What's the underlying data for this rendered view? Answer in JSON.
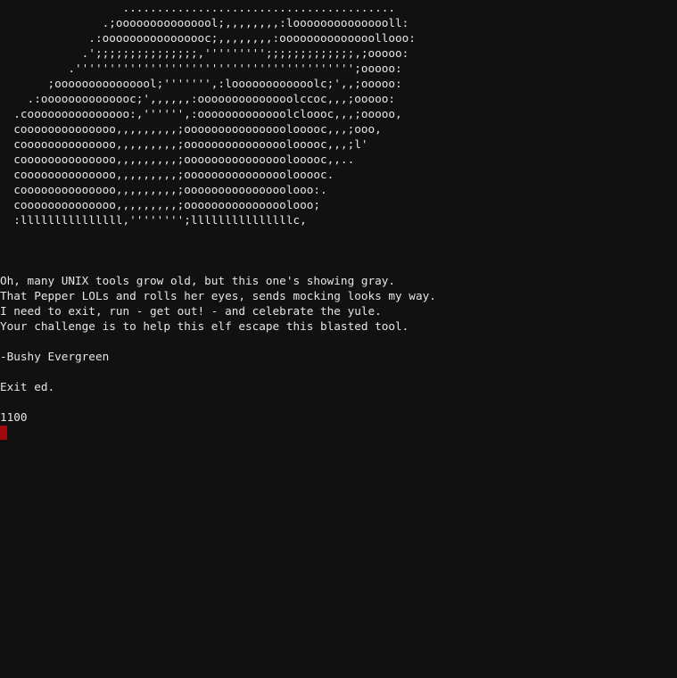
{
  "ascii_art": [
    "                  ........................................",
    "               .;ooooooooooooool;,,,,,,,,:looooooooooooooll:",
    "             .:oooooooooooooooc;,,,,,,,,:oooooooooooooollooo:",
    "            .';;;;;;;;;;;;;;;,''''''''';;;;;;;;;;;;;,;ooooo:",
    "          .''''''''''''''''''''''''''''''''''''''''';ooooo:",
    "       ;ooooooooooooool;''''''',:loooooooooooolc;',,;ooooo:",
    "    .:oooooooooooooc;',,,,,,:oooooooooooooolccoc,,,;ooooo:",
    "  .cooooooooooooooo:,'''''',:ooooooooooooolcloooc,,,;ooooo,",
    "  coooooooooooooo,,,,,,,,,;ooooooooooooooolooooc,,,;ooo,",
    "  coooooooooooooo,,,,,,,,,;ooooooooooooooolooooc,,,;l'",
    "  coooooooooooooo,,,,,,,,,;ooooooooooooooolooooc,,..",
    "  coooooooooooooo,,,,,,,,,;ooooooooooooooolooooc.",
    "  coooooooooooooo,,,,,,,,,;ooooooooooooooolooo:.",
    "  coooooooooooooo,,,,,,,,,;ooooooooooooooolooo;",
    "  :lllllllllllllll,'''''''';lllllllllllllllc,"
  ],
  "poem": {
    "line1": "Oh, many UNIX tools grow old, but this one's showing gray.",
    "line2": "That Pepper LOLs and rolls her eyes, sends mocking looks my way.",
    "line3": "I need to exit, run - get out! - and celebrate the yule.",
    "line4": "Your challenge is to help this elf escape this blasted tool."
  },
  "signature": "-Bushy Evergreen",
  "task": "Exit ed.",
  "output": "1100"
}
